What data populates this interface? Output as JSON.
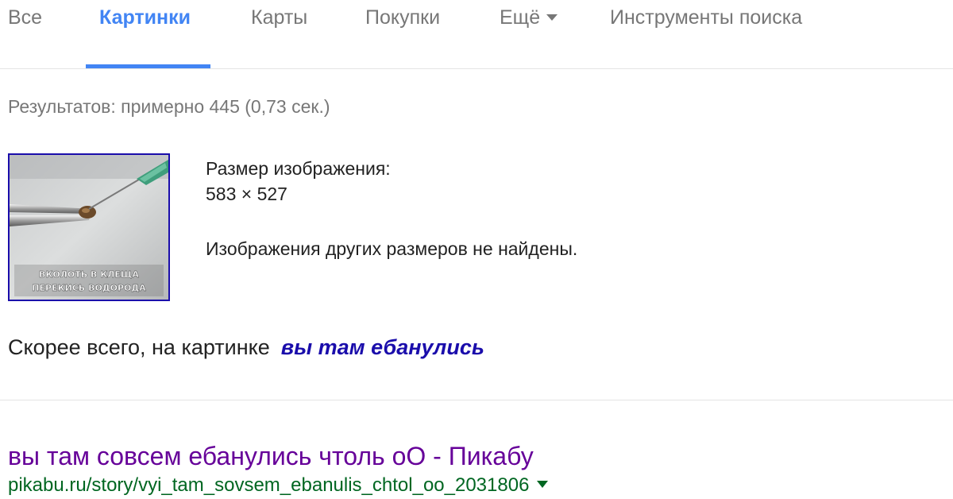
{
  "tabs": [
    {
      "label": "Все"
    },
    {
      "label": "Картинки"
    },
    {
      "label": "Карты"
    },
    {
      "label": "Покупки"
    },
    {
      "label": "Ещё"
    },
    {
      "label": "Инструменты поиска"
    }
  ],
  "active_tab": "Картинки",
  "result_stats": "Результатов: примерно 445 (0,73 сек.)",
  "image_info": {
    "size_label": "Размер изображения:",
    "size_value": "583 × 527",
    "no_other_sizes": "Изображения других размеров не найдены.",
    "thumbnail_caption_line1": "ВКОЛОТЬ В КЛЕЩА",
    "thumbnail_caption_line2": "ПЕРЕКИСЬ ВОДОРОДА"
  },
  "best_guess": {
    "prefix": "Скорее всего, на картинке",
    "query": "вы там ебанулись"
  },
  "results": [
    {
      "title": "вы там совсем ебанулись чтоль оО - Пикабу",
      "url": "pikabu.ru/story/vyi_tam_sovsem_ebanulis_chtol_oo_2031806"
    }
  ],
  "colors": {
    "accent": "#4285f4",
    "link": "#1a0dab",
    "visited": "#660099",
    "url": "#006621",
    "muted": "#777777"
  }
}
